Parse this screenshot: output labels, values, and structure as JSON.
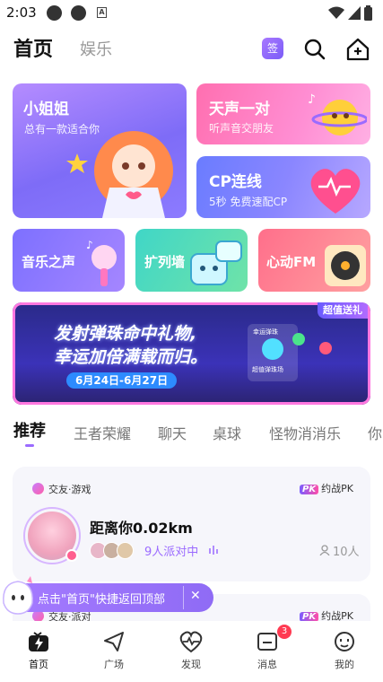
{
  "status_bar": {
    "time": "2:03",
    "a_badge": "A"
  },
  "top_nav": {
    "title": "首页",
    "tab_entertainment": "娱乐",
    "sign_label": "签"
  },
  "feature_cards": {
    "xiaojiejie": {
      "title": "小姐姐",
      "subtitle": "总有一款适合你"
    },
    "tiansheng": {
      "title": "天声一对",
      "subtitle": "听声音交朋友"
    },
    "cp": {
      "title": "CP连线",
      "subtitle": "5秒 免费速配CP"
    },
    "music": {
      "title": "音乐之声"
    },
    "kuolie": {
      "title": "扩列墙"
    },
    "fm": {
      "title": "心动FM"
    }
  },
  "banner": {
    "tag": "超值送礼",
    "line1": "发射弹珠命中礼物,",
    "line2": "幸运加倍满载而归。",
    "date": "6月24日-6月27日",
    "mini_tag": "幸运弹珠",
    "mini_label": "超值弹珠场"
  },
  "category_tabs": [
    "推荐",
    "王者荣耀",
    "聊天",
    "桌球",
    "怪物消消乐",
    "你"
  ],
  "rooms": [
    {
      "tag": "交友·游戏",
      "pk_logo": "PK",
      "pk_label": "约战PK",
      "title": "距离你0.02km",
      "party_text": "9人派对中",
      "count": "10人"
    },
    {
      "tag": "交友·派对",
      "pk_logo": "PK",
      "pk_label": "约战PK"
    }
  ],
  "toast": {
    "text": "点击\"首页\"快捷返回顶部",
    "close": "✕"
  },
  "bottom_nav": [
    {
      "label": "首页",
      "icon": "home-icon"
    },
    {
      "label": "广场",
      "icon": "plaza-icon"
    },
    {
      "label": "发现",
      "icon": "discover-icon"
    },
    {
      "label": "消息",
      "icon": "message-icon"
    },
    {
      "label": "我的",
      "icon": "profile-icon"
    }
  ],
  "message_badge": "3",
  "colors": {
    "accent": "#9b6bff",
    "badge": "#ff3a52"
  }
}
